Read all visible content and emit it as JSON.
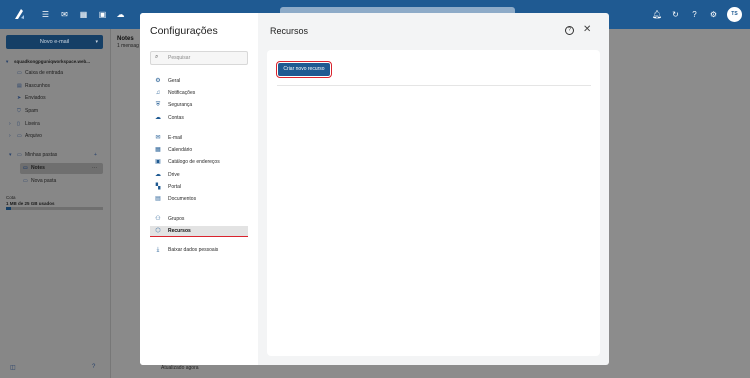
{
  "topbar": {
    "icons": [
      "menu-icon",
      "mail-icon",
      "calendar-icon",
      "contacts-icon",
      "cloud-icon",
      "notification-icon",
      "refresh-icon",
      "help-icon",
      "settings-icon"
    ],
    "avatar_initials": "TS"
  },
  "sidebar": {
    "new_mail_label": "Novo e-mail",
    "account": "squadkongpguniqworkspace.web...",
    "folders": [
      {
        "label": "Caixa de entrada",
        "icon": "inbox-icon"
      },
      {
        "label": "Rascunhos",
        "icon": "drafts-icon"
      },
      {
        "label": "Enviados",
        "icon": "sent-icon"
      },
      {
        "label": "Spam",
        "icon": "spam-icon"
      },
      {
        "label": "Lixeira",
        "icon": "trash-icon"
      },
      {
        "label": "Arquivo",
        "icon": "archive-icon"
      }
    ],
    "my_folders_label": "Minhas pastas",
    "sub_folders": [
      {
        "label": "Notes",
        "selected": true
      },
      {
        "label": "Nova pasta",
        "selected": false
      }
    ],
    "quota_label": "Cota",
    "quota_text": "1 MB de 25 GB usados",
    "quota_fraction": 0.05
  },
  "list": {
    "title": "Notes",
    "subtitle": "1 mensag",
    "footer": "Atualizado agora"
  },
  "modal": {
    "title": "Configurações",
    "search_placeholder": "Pesquisar",
    "nav_groups": [
      [
        {
          "label": "Geral",
          "icon": "gear-icon"
        },
        {
          "label": "Notificações",
          "icon": "bell-icon"
        },
        {
          "label": "Segurança",
          "icon": "shield-icon"
        },
        {
          "label": "Contas",
          "icon": "cloud-icon"
        }
      ],
      [
        {
          "label": "E-mail",
          "icon": "mail-icon"
        },
        {
          "label": "Calendário",
          "icon": "calendar-icon"
        },
        {
          "label": "Catálogo de endereços",
          "icon": "contacts-icon"
        },
        {
          "label": "Drive",
          "icon": "cloud-icon"
        },
        {
          "label": "Portal",
          "icon": "grid-icon"
        },
        {
          "label": "Documentos",
          "icon": "document-icon"
        }
      ],
      [
        {
          "label": "Grupos",
          "icon": "users-icon"
        },
        {
          "label": "Recursos",
          "icon": "cube-icon",
          "active": true
        }
      ],
      [
        {
          "label": "Baixar dados pessoais",
          "icon": "download-icon"
        }
      ]
    ],
    "section_title": "Recursos",
    "create_button": "Criar novo recurso"
  },
  "colors": {
    "accent": "#1f5a92",
    "highlight": "#d9232d"
  }
}
